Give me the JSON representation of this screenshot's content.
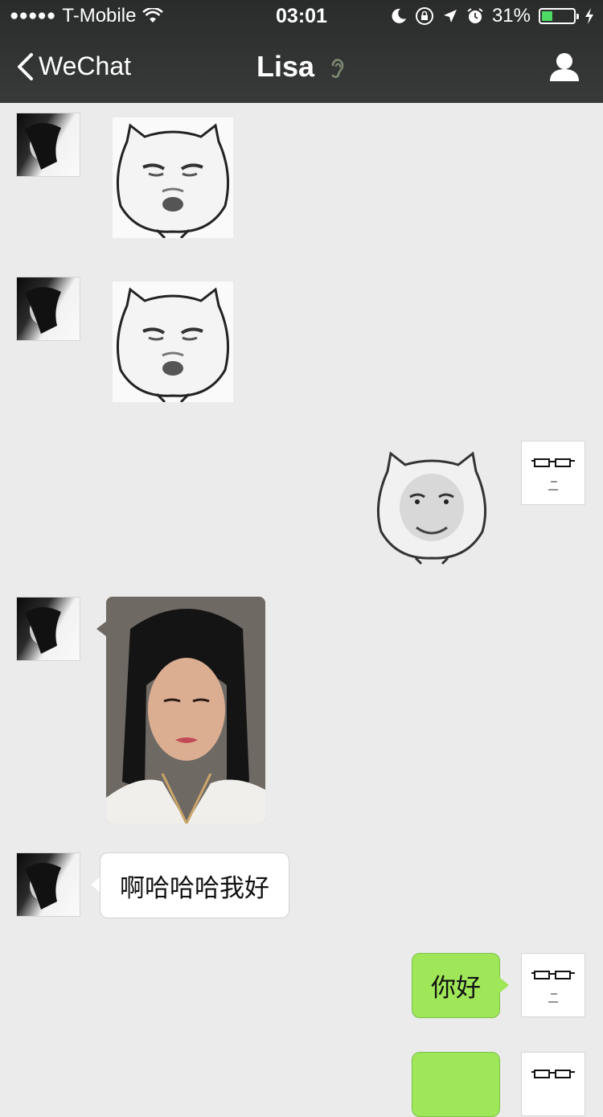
{
  "status_bar": {
    "carrier": "T-Mobile",
    "signal_dots": "●●●●●",
    "time": "03:01",
    "battery_text": "31%",
    "battery_level": 0.31
  },
  "nav": {
    "back_label": "WeChat",
    "title": "Lisa"
  },
  "messages": [
    {
      "id": 1,
      "sender": "Lisa",
      "type": "sticker",
      "sticker": "grumpy-cat-face"
    },
    {
      "id": 2,
      "sender": "Lisa",
      "type": "sticker",
      "sticker": "grumpy-cat-face"
    },
    {
      "id": 3,
      "sender": "me",
      "type": "sticker",
      "sticker": "smiling-man-cat-face"
    },
    {
      "id": 4,
      "sender": "Lisa",
      "type": "photo",
      "photo": "selfie-portrait"
    },
    {
      "id": 5,
      "sender": "Lisa",
      "type": "text",
      "text": "啊哈哈哈我好"
    },
    {
      "id": 6,
      "sender": "me",
      "type": "text",
      "text": "你好"
    },
    {
      "id": 7,
      "sender": "me",
      "type": "text",
      "text": ""
    }
  ],
  "colors": {
    "background": "#ebebeb",
    "nav_bar": "#333434",
    "sent_bubble": "#9fe658",
    "received_bubble": "#ffffff",
    "battery_fill": "#4cd964"
  }
}
